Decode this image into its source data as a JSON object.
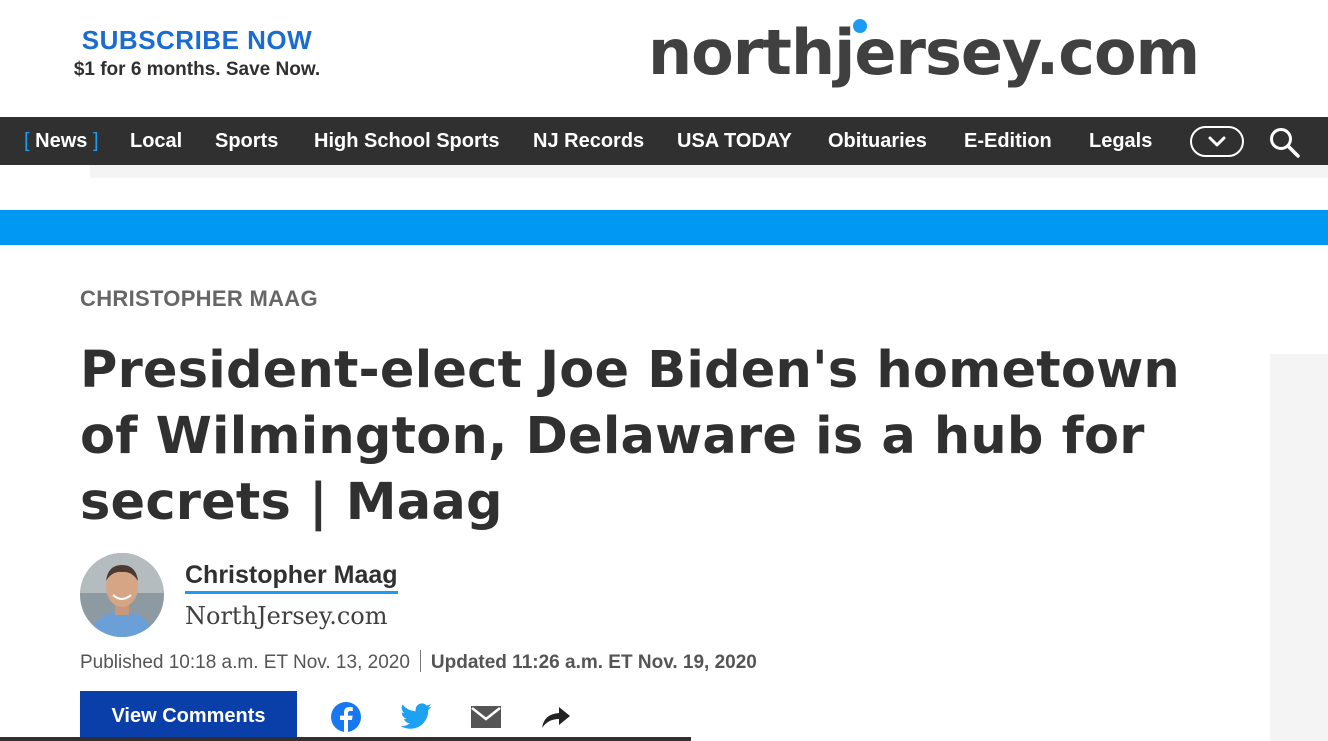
{
  "header": {
    "subscribe_title": "SUBSCRIBE NOW",
    "subscribe_sub": "$1 for 6 months. Save Now.",
    "logo": "northjersey.com"
  },
  "nav": {
    "items": [
      {
        "label": "News"
      },
      {
        "label": "Local"
      },
      {
        "label": "Sports"
      },
      {
        "label": "High School Sports"
      },
      {
        "label": "NJ Records"
      },
      {
        "label": "USA TODAY"
      },
      {
        "label": "Obituaries"
      },
      {
        "label": "E-Edition"
      },
      {
        "label": "Legals"
      }
    ],
    "bracket_open": "[",
    "bracket_close": "]",
    "more_icon": "chevron-down-icon",
    "search_icon": "search-icon"
  },
  "article": {
    "section": "CHRISTOPHER MAAG",
    "headline": "President-elect Joe Biden's hometown of Wilmington, Delaware is a hub for secrets | Maag",
    "author_name": "Christopher Maag",
    "author_org": "NorthJersey.com",
    "published": "Published 10:18 a.m. ET Nov. 13, 2020",
    "updated": "Updated 11:26 a.m. ET Nov. 19, 2020"
  },
  "actions": {
    "comments_label": "View Comments",
    "share_icons": [
      "facebook-icon",
      "twitter-icon",
      "email-icon",
      "share-icon"
    ]
  },
  "colors": {
    "brand_blue": "#1a6cd1",
    "accent_blue": "#0098f3",
    "nav_bg": "#303030",
    "button_blue": "#0a3ea8"
  }
}
